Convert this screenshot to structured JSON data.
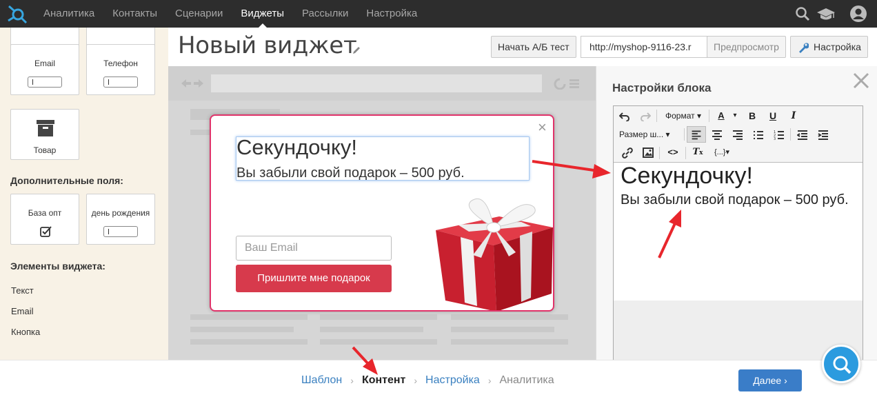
{
  "nav": {
    "items": [
      "Аналитика",
      "Контакты",
      "Сценарии",
      "Виджеты",
      "Рассылки",
      "Настройка"
    ],
    "active_index": 3
  },
  "sidebar": {
    "tiles_row1": [
      "Email",
      "Телефон"
    ],
    "tile_product": "Товар",
    "extra_fields_title": "Дополнительные поля:",
    "extra_fields": [
      "База опт",
      "день рождения"
    ],
    "widget_elements_title": "Элементы виджета:",
    "widget_elements": [
      "Текст",
      "Email",
      "Кнопка"
    ]
  },
  "header": {
    "title": "Новый виджет",
    "ab_test_label": "Начать А/Б тест",
    "url_value": "http://myshop-9116-23.r",
    "preview_label": "Предпросмотр",
    "settings_label": "Настройка"
  },
  "popup": {
    "heading": "Секундочку!",
    "subtext": "Вы забыли свой подарок – 500 руб.",
    "email_placeholder": "Ваш Email",
    "submit_label": "Пришлите мне подарок"
  },
  "panel": {
    "title": "Настройки блока",
    "format_label": "Формат",
    "font_size_label": "Размер ш...",
    "vars_label": "{...}",
    "editor_heading": "Секундочку!",
    "editor_subtext": "Вы забыли свой подарок – 500 руб."
  },
  "footer": {
    "steps": [
      "Шаблон",
      "Контент",
      "Настройка",
      "Аналитика"
    ],
    "current_step": 1,
    "next_label": "Далее"
  },
  "colors": {
    "nav_bg": "#2d2d2d",
    "popup_border": "#e0336a",
    "submit_bg": "#d73a4c",
    "link": "#3a80c0",
    "next_bg": "#3a7dc8",
    "annotation_arrow": "#e8262c"
  }
}
